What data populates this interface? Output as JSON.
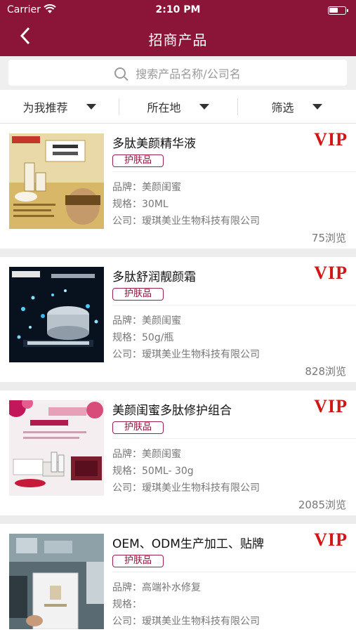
{
  "status_bar": {
    "carrier": "Carrier",
    "time": "2:10 PM"
  },
  "header": {
    "title": "招商产品"
  },
  "search": {
    "placeholder": "搜索产品名称/公司名"
  },
  "filters": [
    {
      "label": "为我推荐"
    },
    {
      "label": "所在地"
    },
    {
      "label": "筛选"
    }
  ],
  "labels": {
    "brand": "品牌：",
    "spec": "规格：",
    "company": "公司："
  },
  "products": [
    {
      "name": "多肽美颜精华液",
      "badge": "VIP",
      "category": "护肤品",
      "brand": "美颜闺蜜",
      "spec": "30ML",
      "company": "瑷琪美业生物科技有限公司",
      "views": "75浏览"
    },
    {
      "name": "多肽舒润靓颜霜",
      "badge": "VIP",
      "category": "护肤品",
      "brand": "美颜闺蜜",
      "spec": "50g/瓶",
      "company": "瑷琪美业生物科技有限公司",
      "views": "828浏览"
    },
    {
      "name": "美颜闺蜜多肽修护组合",
      "badge": "VIP",
      "category": "护肤品",
      "brand": "美颜闺蜜",
      "spec": "50ML- 30g",
      "company": "瑷琪美业生物科技有限公司",
      "views": "2085浏览"
    },
    {
      "name": "OEM、ODM生产加工、贴牌",
      "badge": "VIP",
      "category": "护肤品",
      "brand": "高端补水修复",
      "spec": "",
      "company": "瑷琪美业生物科技有限公司",
      "views": ""
    }
  ]
}
